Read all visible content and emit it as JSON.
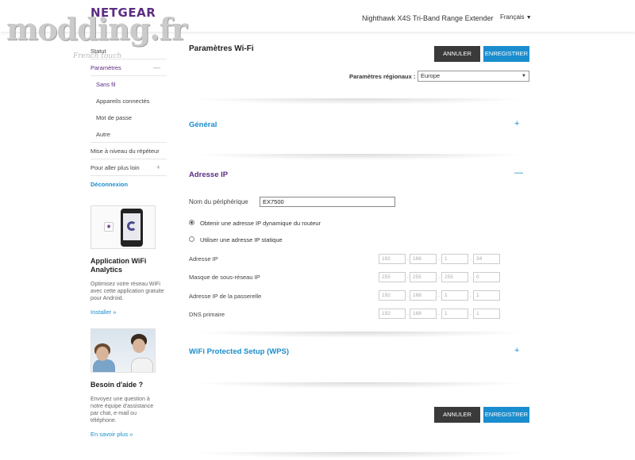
{
  "brand": {
    "logo": "NETGEAR",
    "watermark": "modding.fr",
    "watermark_sub": "French touch"
  },
  "header": {
    "product_name": "Nighthawk X4S Tri-Band Range Extender",
    "language": "Français"
  },
  "sidebar": {
    "items": {
      "status": "Statut",
      "settings": "Paramètres",
      "wireless": "Sans fil",
      "connected_devices": "Appareils connectés",
      "password": "Mot de passe",
      "other": "Autre",
      "firmware_update": "Mise à niveau du répéteur",
      "go_further": "Pour aller plus loin",
      "logout": "Déconnexion"
    },
    "app_promo": {
      "title": "Application WiFi Analytics",
      "text": "Optimisez votre réseau WiFi avec cette application gratuite pour Android.",
      "link": "Installer »"
    },
    "help_promo": {
      "title": "Besoin d'aide ?",
      "text": "Envoyez une question à notre équipe d'assistance par chat, e-mail ou téléphone.",
      "link": "En savoir plus »"
    }
  },
  "main": {
    "title": "Paramètres Wi-Fi",
    "cancel_label": "ANNULER",
    "save_label": "ENREGISTRER",
    "region_label": "Paramètres régionaux :",
    "region_value": "Europe",
    "sections": {
      "general": "Général",
      "ip_address": "Adresse IP",
      "wps": "WiFi Protected Setup (WPS)"
    },
    "ip": {
      "device_name_label": "Nom du périphérique",
      "device_name_value": "EX7500",
      "dynamic_label": "Obtenir une adresse IP dynamique du routeur",
      "static_label": "Utiliser une adresse IP statique",
      "ip_label": "Adresse IP",
      "subnet_label": "Masque de sous-réseau IP",
      "gateway_label": "Adresse IP de la passerelle",
      "dns_label": "DNS primaire",
      "ip_values": [
        "192",
        "168",
        "1",
        "34"
      ],
      "subnet_values": [
        "255",
        "255",
        "255",
        "0"
      ],
      "gateway_values": [
        "192",
        "168",
        "1",
        "1"
      ],
      "dns_values": [
        "192",
        "168",
        "1",
        "1"
      ]
    }
  },
  "colors": {
    "brand_purple": "#5c2d82",
    "accent_blue": "#1a8dce",
    "dark_button": "#3a3a3a"
  },
  "icons": {
    "language_caret": "caret-down-icon",
    "section_expand": "plus-icon",
    "section_collapse": "minus-icon"
  }
}
